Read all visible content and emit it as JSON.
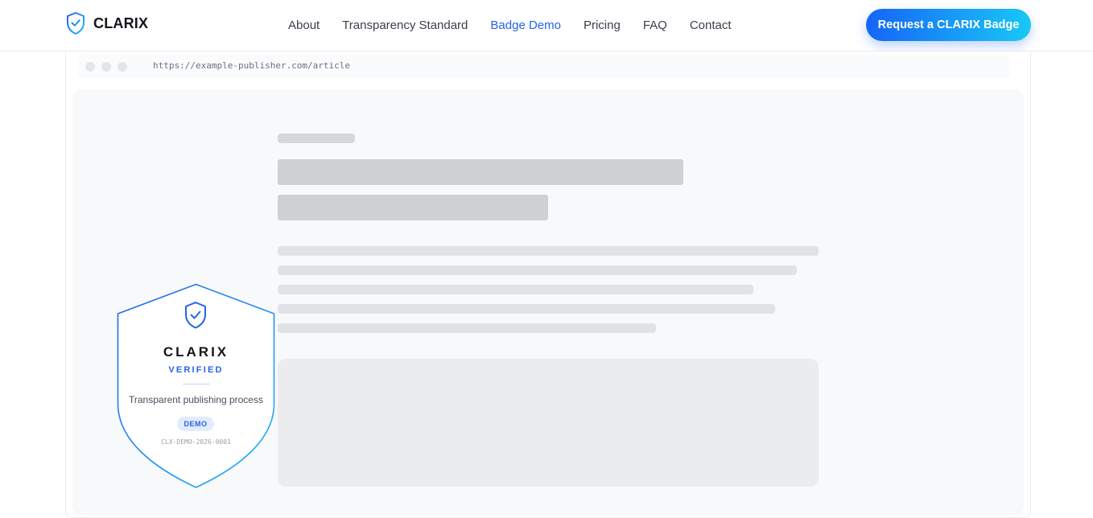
{
  "header": {
    "brand_name": "CLARIX",
    "brand_icon": "shield-check-icon",
    "nav": [
      {
        "label": "About",
        "active": false
      },
      {
        "label": "Transparency Standard",
        "active": false
      },
      {
        "label": "Badge Demo",
        "active": true
      },
      {
        "label": "Pricing",
        "active": false
      },
      {
        "label": "FAQ",
        "active": false
      },
      {
        "label": "Contact",
        "active": false
      }
    ],
    "cta_label": "Request a CLARIX Badge"
  },
  "browser": {
    "url": "https://example-publisher.com/article"
  },
  "badge": {
    "name": "CLARIX",
    "verified_label": "VERIFIED",
    "tagline": "Transparent publishing process",
    "pill_label": "DEMO",
    "id": "CLX-DEMO-2026-0001",
    "icon": "shield-check-icon"
  },
  "colors": {
    "accent": "#2563eb",
    "cta_gradient_start": "#1565f6",
    "cta_gradient_end": "#19c8f5",
    "badge_border_start": "#2563eb",
    "badge_border_end": "#22b8f5"
  }
}
